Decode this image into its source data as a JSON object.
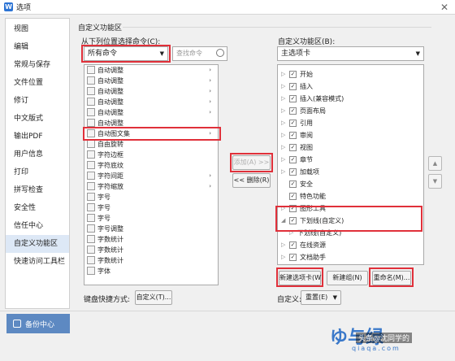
{
  "window": {
    "title": "选项"
  },
  "sidebar": {
    "items": [
      {
        "label": "视图"
      },
      {
        "label": "编辑"
      },
      {
        "label": "常规与保存"
      },
      {
        "label": "文件位置"
      },
      {
        "label": "修订"
      },
      {
        "label": "中文版式"
      },
      {
        "label": "输出PDF"
      },
      {
        "label": "用户信息"
      },
      {
        "label": "打印"
      },
      {
        "label": "拼写检查"
      },
      {
        "label": "安全性"
      },
      {
        "label": "信任中心"
      },
      {
        "label": "自定义功能区"
      },
      {
        "label": "快速访问工具栏"
      }
    ],
    "active": "自定义功能区"
  },
  "backup": {
    "label": "备份中心"
  },
  "section": {
    "title": "自定义功能区"
  },
  "left": {
    "label": "从下列位置选择命令(C):",
    "combo": "所有命令",
    "search_placeholder": "查找命令",
    "items": [
      {
        "label": "自动调整",
        "sub": "›"
      },
      {
        "label": "自动调整",
        "sub": "›"
      },
      {
        "label": "自动调整",
        "sub": "›"
      },
      {
        "label": "自动调整",
        "sub": "›"
      },
      {
        "label": "自动调整",
        "sub": "›"
      },
      {
        "label": "自动调整",
        "sub": ""
      },
      {
        "label": "自动图文集",
        "sub": "›"
      },
      {
        "label": "自由旋转",
        "sub": ""
      },
      {
        "label": "字符边框",
        "sub": ""
      },
      {
        "label": "字符底纹",
        "sub": ""
      },
      {
        "label": "字符间距",
        "sub": "›"
      },
      {
        "label": "字符缩放",
        "sub": "›"
      },
      {
        "label": "字号",
        "sub": ""
      },
      {
        "label": "字号",
        "sub": ""
      },
      {
        "label": "字号",
        "sub": ""
      },
      {
        "label": "字号调整",
        "sub": ""
      },
      {
        "label": "字数统计",
        "sub": ""
      },
      {
        "label": "字数统计",
        "sub": ""
      },
      {
        "label": "字数统计",
        "sub": ""
      },
      {
        "label": "字体",
        "sub": ""
      }
    ]
  },
  "middle": {
    "add": "添加(A) >>",
    "remove": "<< 删除(R)"
  },
  "right": {
    "label": "自定义功能区(B):",
    "combo": "主选项卡",
    "items": [
      {
        "label": "开始",
        "tog": "▷",
        "checked": "✓"
      },
      {
        "label": "插入",
        "tog": "▷",
        "checked": "✓"
      },
      {
        "label": "插入(兼容模式)",
        "tog": "▷",
        "checked": "✓"
      },
      {
        "label": "页面布局",
        "tog": "▷",
        "checked": "✓"
      },
      {
        "label": "引用",
        "tog": "▷",
        "checked": "✓"
      },
      {
        "label": "审阅",
        "tog": "▷",
        "checked": "✓"
      },
      {
        "label": "视图",
        "tog": "▷",
        "checked": "✓"
      },
      {
        "label": "章节",
        "tog": "▷",
        "checked": "✓"
      },
      {
        "label": "加载项",
        "tog": "▷",
        "checked": "✓"
      },
      {
        "label": "安全",
        "tog": "",
        "checked": "✓"
      },
      {
        "label": "特色功能",
        "tog": "",
        "checked": "✓"
      },
      {
        "label": "图形工具",
        "tog": "▷",
        "checked": "✓"
      },
      {
        "label": "下划线(自定义)",
        "tog": "◢",
        "checked": "✓"
      },
      {
        "label": "下划线(自定义)",
        "tog": "▷",
        "checked": ""
      },
      {
        "label": "在线资源",
        "tog": "▷",
        "checked": "✓"
      },
      {
        "label": "文档助手",
        "tog": "▷",
        "checked": "✓"
      }
    ],
    "new_tab": "新建选项卡(W)",
    "new_group": "新建组(N)",
    "rename": "重命名(M)..."
  },
  "keyboard": {
    "label": "键盘快捷方式:",
    "button": "自定义(T)..."
  },
  "customize": {
    "label": "自定义:",
    "reset": "重置(E)"
  },
  "watermark": {
    "logo": "ゆ与绿",
    "url": "qiaqa.com",
    "caption": "头条@沈同学的"
  }
}
